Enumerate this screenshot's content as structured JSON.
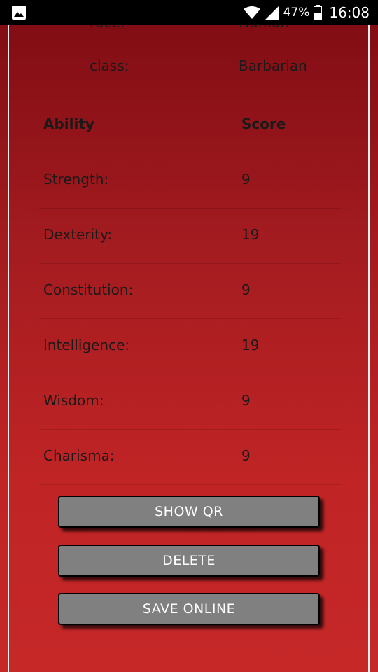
{
  "status_bar": {
    "battery_percent": "47%",
    "time": "16:08"
  },
  "character": {
    "race_label": "race:",
    "race_value": "Human",
    "class_label": "class:",
    "class_value": "Barbarian"
  },
  "abilities": {
    "header": {
      "ability": "Ability",
      "score": "Score"
    },
    "rows": [
      {
        "name": "Strength:",
        "score": "9"
      },
      {
        "name": "Dexterity:",
        "score": "19"
      },
      {
        "name": "Constitution:",
        "score": "9"
      },
      {
        "name": "Intelligence:",
        "score": "19"
      },
      {
        "name": "Wisdom:",
        "score": "9"
      },
      {
        "name": "Charisma:",
        "score": "9"
      }
    ]
  },
  "buttons": {
    "show_qr": "SHOW QR",
    "delete": "DELETE",
    "save_online": "SAVE ONLINE"
  },
  "colors": {
    "background_top": "#820d14",
    "background_bottom": "#c62828",
    "button": "#808080"
  }
}
